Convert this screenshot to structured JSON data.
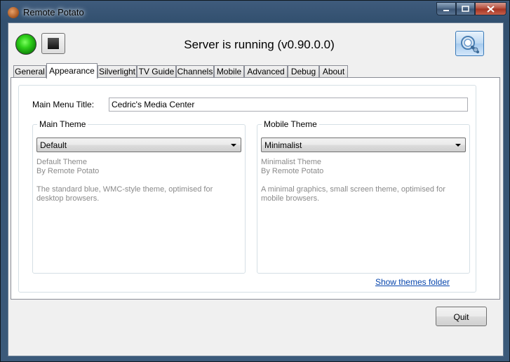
{
  "window": {
    "title": "Remote Potato",
    "controls": {
      "minimize": "minimize-icon",
      "maximize": "maximize-icon",
      "close": "close-icon"
    }
  },
  "toolbar": {
    "start_button_icon": "green-start-icon",
    "stop_button_icon": "stop-square-icon",
    "status_text": "Server is running (v0.90.0.0)",
    "settings_button_icon": "settings-gear-icon"
  },
  "tabs": [
    {
      "label": "General"
    },
    {
      "label": "Appearance",
      "active": true
    },
    {
      "label": "Silverlight"
    },
    {
      "label": "TV Guide"
    },
    {
      "label": "Channels"
    },
    {
      "label": "Mobile"
    },
    {
      "label": "Advanced"
    },
    {
      "label": "Debug"
    },
    {
      "label": "About"
    }
  ],
  "appearance": {
    "menu_title_label": "Main Menu Title:",
    "menu_title_value": "Cedric's Media Center",
    "main_theme": {
      "group_title": "Main Theme",
      "selected": "Default",
      "name": "Default Theme",
      "author": "By Remote Potato",
      "description": "The standard blue, WMC-style theme, optimised for desktop browsers."
    },
    "mobile_theme": {
      "group_title": "Mobile Theme",
      "selected": "Minimalist",
      "name": "Minimalist Theme",
      "author": "By Remote Potato",
      "description": "A minimal graphics, small screen theme, optimised for mobile browsers."
    },
    "show_themes_link": "Show themes folder"
  },
  "footer": {
    "quit_label": "Quit"
  },
  "colors": {
    "link": "#0645ad",
    "status_green": "#2fd01a",
    "hint_text": "#8a8a8a"
  }
}
